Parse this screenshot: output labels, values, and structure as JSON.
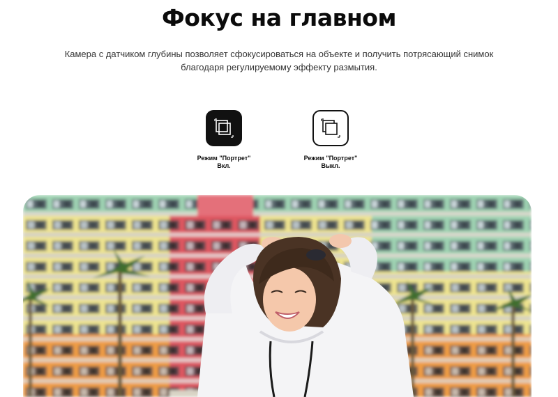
{
  "heading": "Фокус на главном",
  "description_line1": "Камера с датчиком глубины позволяет сфокусироваться на объекте и получить потрясающий снимок",
  "description_line2": "благодаря регулируемому эффекту размытия.",
  "modes": [
    {
      "label_line1": "Режим \"Портрет\"",
      "label_line2": "Вкл.",
      "icon": "portrait-mode-on-icon",
      "active": true
    },
    {
      "label_line1": "Режим \"Портрет\"",
      "label_line2": "Выкл.",
      "icon": "portrait-mode-off-icon",
      "active": false
    }
  ],
  "colors": {
    "accent": "#111111",
    "background": "#ffffff",
    "building_green": "#8fcaa8",
    "building_yellow": "#ece58a",
    "building_red": "#e0505a",
    "building_orange": "#ee9a3e"
  }
}
